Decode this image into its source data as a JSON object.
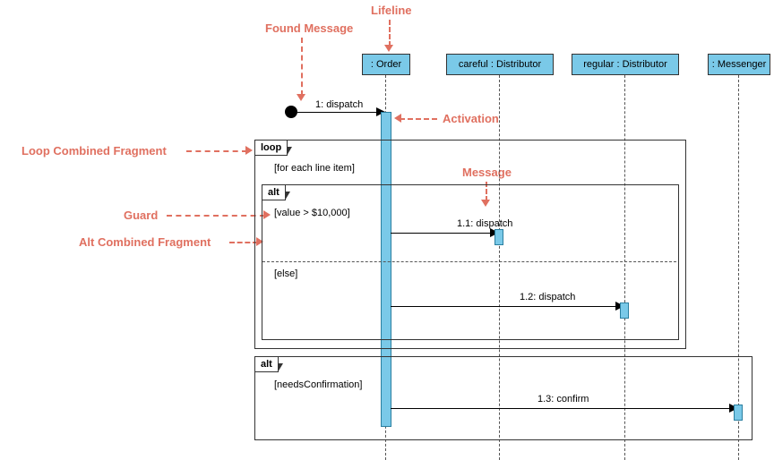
{
  "annotations": {
    "lifeline": "Lifeline",
    "found_message": "Found Message",
    "activation": "Activation",
    "loop_fragment": "Loop Combined Fragment",
    "message": "Message",
    "guard": "Guard",
    "alt_fragment": "Alt Combined Fragment"
  },
  "lifelines": {
    "order": ": Order",
    "careful": "careful : Distributor",
    "regular": "regular : Distributor",
    "messenger": ": Messenger"
  },
  "fragments": {
    "loop_label": "loop",
    "loop_guard": "[for each line item]",
    "alt1_label": "alt",
    "alt1_guard_if": "[value > $10,000]",
    "alt1_guard_else": "[else]",
    "alt2_label": "alt",
    "alt2_guard": "[needsConfirmation]"
  },
  "messages": {
    "m1": "1: dispatch",
    "m11": "1.1: dispatch",
    "m12": "1.2: dispatch",
    "m13": "1.3: confirm"
  },
  "chart_data": {
    "type": "uml_sequence_diagram",
    "lifelines": [
      {
        "id": "order",
        "name": ": Order"
      },
      {
        "id": "careful",
        "name": "careful : Distributor"
      },
      {
        "id": "regular",
        "name": "regular : Distributor"
      },
      {
        "id": "messenger",
        "name": ": Messenger"
      }
    ],
    "found_message": {
      "to": "order",
      "label": "1: dispatch"
    },
    "fragments": [
      {
        "type": "loop",
        "guard": "[for each line item]",
        "contains": [
          {
            "type": "alt",
            "operands": [
              {
                "guard": "[value > $10,000]",
                "messages": [
                  {
                    "from": "order",
                    "to": "careful",
                    "label": "1.1: dispatch"
                  }
                ]
              },
              {
                "guard": "[else]",
                "messages": [
                  {
                    "from": "order",
                    "to": "regular",
                    "label": "1.2: dispatch"
                  }
                ]
              }
            ]
          }
        ]
      },
      {
        "type": "alt",
        "operands": [
          {
            "guard": "[needsConfirmation]",
            "messages": [
              {
                "from": "order",
                "to": "messenger",
                "label": "1.3: confirm"
              }
            ]
          }
        ]
      }
    ]
  }
}
